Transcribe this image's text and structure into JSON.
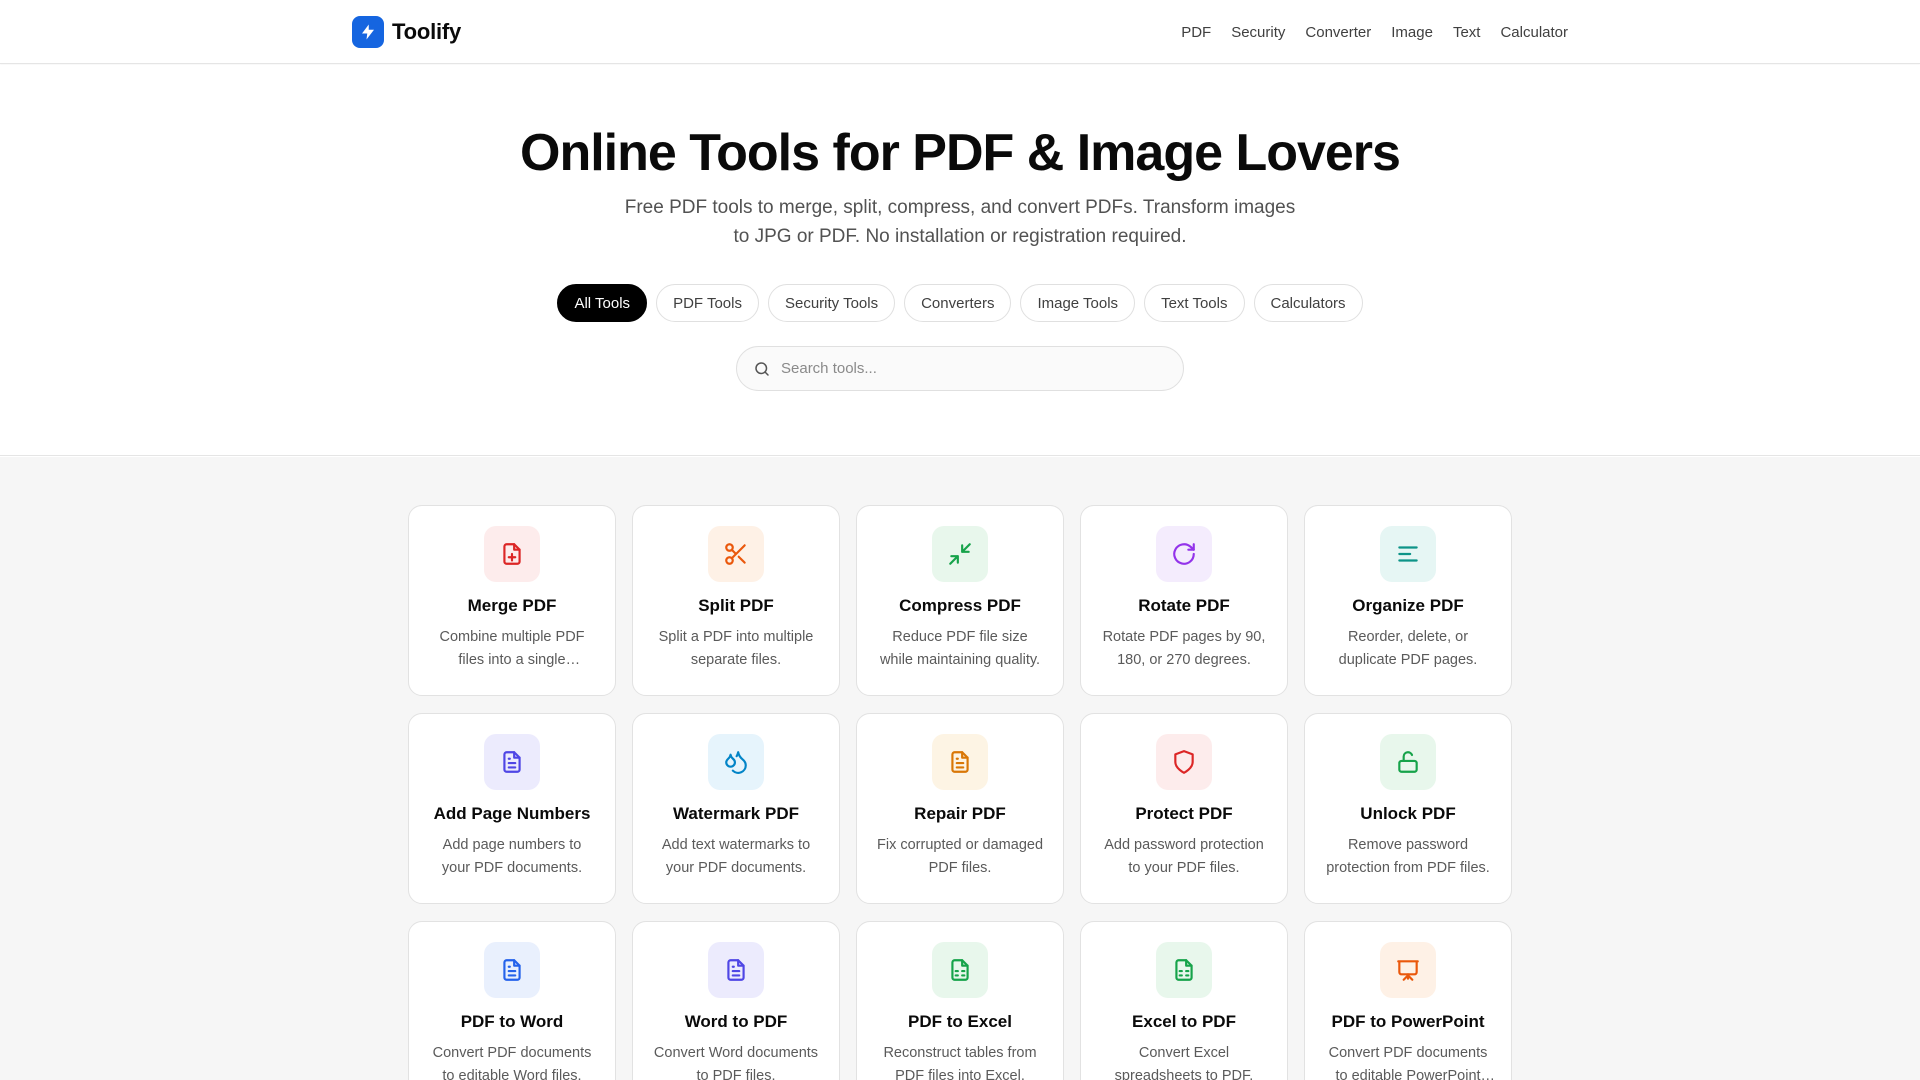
{
  "app": {
    "name": "Toolify",
    "brand_color": "#1565e0"
  },
  "nav": {
    "items": [
      "PDF",
      "Security",
      "Converter",
      "Image",
      "Text",
      "Calculator"
    ]
  },
  "hero": {
    "title": "Online Tools for PDF & Image Lovers",
    "subtitle": "Free PDF tools to merge, split, compress, and convert PDFs. Transform images to JPG or PDF. No installation or registration required."
  },
  "filters": {
    "active": "All Tools",
    "items": [
      "All Tools",
      "PDF Tools",
      "Security Tools",
      "Converters",
      "Image Tools",
      "Text Tools",
      "Calculators"
    ]
  },
  "search": {
    "placeholder": "Search tools..."
  },
  "tools": [
    {
      "title": "Merge PDF",
      "desc": "Combine multiple PDF files into a single document.",
      "icon": "file-plus-icon",
      "color": "#dc2626",
      "bg": "#fdecec"
    },
    {
      "title": "Split PDF",
      "desc": "Split a PDF into multiple separate files.",
      "icon": "scissors-icon",
      "color": "#ea580c",
      "bg": "#fef1e6"
    },
    {
      "title": "Compress PDF",
      "desc": "Reduce PDF file size while maintaining quality.",
      "icon": "minimize-icon",
      "color": "#16a34a",
      "bg": "#e8f7ec"
    },
    {
      "title": "Rotate PDF",
      "desc": "Rotate PDF pages by 90, 180, or 270 degrees.",
      "icon": "rotate-icon",
      "color": "#9333ea",
      "bg": "#f4ecfd"
    },
    {
      "title": "Organize PDF",
      "desc": "Reorder, delete, or duplicate PDF pages.",
      "icon": "align-left-icon",
      "color": "#0d9488",
      "bg": "#e6f6f4"
    },
    {
      "title": "Add Page Numbers",
      "desc": "Add page numbers to your PDF documents.",
      "icon": "file-text-icon",
      "color": "#4f46e5",
      "bg": "#ecebfd"
    },
    {
      "title": "Watermark PDF",
      "desc": "Add text watermarks to your PDF documents.",
      "icon": "droplets-icon",
      "color": "#0284c7",
      "bg": "#e6f4fc"
    },
    {
      "title": "Repair PDF",
      "desc": "Fix corrupted or damaged PDF files.",
      "icon": "file-text-icon",
      "color": "#d97706",
      "bg": "#fdf4e4"
    },
    {
      "title": "Protect PDF",
      "desc": "Add password protection to your PDF files.",
      "icon": "shield-icon",
      "color": "#dc2626",
      "bg": "#fdecec"
    },
    {
      "title": "Unlock PDF",
      "desc": "Remove password protection from PDF files.",
      "icon": "unlock-icon",
      "color": "#16a34a",
      "bg": "#e8f7ec"
    },
    {
      "title": "PDF to Word",
      "desc": "Convert PDF documents to editable Word files.",
      "icon": "file-text-icon",
      "color": "#2563eb",
      "bg": "#e9f0fd"
    },
    {
      "title": "Word to PDF",
      "desc": "Convert Word documents to PDF files.",
      "icon": "file-text-icon",
      "color": "#4f46e5",
      "bg": "#ecebfd"
    },
    {
      "title": "PDF to Excel",
      "desc": "Reconstruct tables from PDF files into Excel.",
      "icon": "file-spreadsheet-icon",
      "color": "#16a34a",
      "bg": "#e8f7ec"
    },
    {
      "title": "Excel to PDF",
      "desc": "Convert Excel spreadsheets to PDF.",
      "icon": "file-spreadsheet-icon",
      "color": "#16a34a",
      "bg": "#e8f7ec"
    },
    {
      "title": "PDF to PowerPoint",
      "desc": "Convert PDF documents to editable PowerPoint slides.",
      "icon": "presentation-icon",
      "color": "#ea580c",
      "bg": "#fef1e6"
    }
  ]
}
